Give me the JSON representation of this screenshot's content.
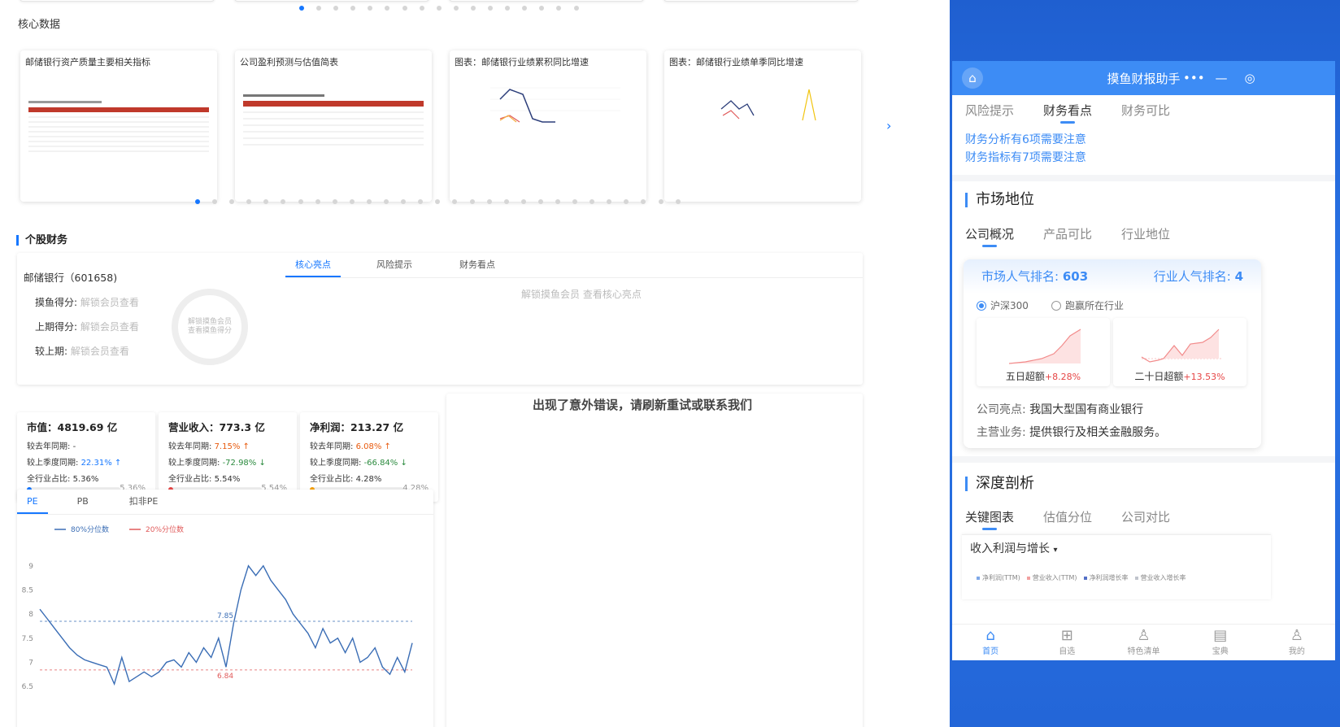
{
  "core_section": {
    "title": "核心数据"
  },
  "cards": [
    {
      "title": "邮储银行资产质量主要相关指标"
    },
    {
      "title": "公司盈利预测与估值简表"
    },
    {
      "title": "图表：邮储银行业绩累积同比增速"
    },
    {
      "title": "图表：邮储银行业绩单季同比增速"
    }
  ],
  "stock_section": {
    "title": "个股财务"
  },
  "stock": {
    "name": "邮储银行（601658)",
    "tabs": [
      "核心亮点",
      "风险提示",
      "财务看点"
    ],
    "active_tab": 0,
    "score_label": "摸鱼得分:",
    "last_score_label": "上期得分:",
    "compare_label": "较上期:",
    "locked_value": "解锁会员查看",
    "ring_text": "解锁摸鱼会员\n查看摸鱼得分",
    "content_placeholder": "解锁摸鱼会员 查看核心亮点"
  },
  "metrics": [
    {
      "title": "市值：4819.69 亿",
      "yoy_label": "较去年同期:",
      "yoy_value": "-",
      "qoq_label": "较上季度同期:",
      "qoq_value": "22.31%",
      "qoq_arrow": "↑",
      "share_label": "全行业占比:",
      "share_value": "5.36%",
      "share_pct": "5.36%",
      "bar_color": "#1677ff",
      "fill": 0.0536
    },
    {
      "title": "营业收入：773.3 亿",
      "yoy_label": "较去年同期:",
      "yoy_value": "7.15%",
      "yoy_arrow": "↑",
      "qoq_label": "较上季度同期:",
      "qoq_value": "-72.98%",
      "qoq_arrow": "↓",
      "share_label": "全行业占比:",
      "share_value": "5.54%",
      "share_pct": "5.54%",
      "bar_color": "#e64545",
      "fill": 0.0554
    },
    {
      "title": "净利润：213.27 亿",
      "yoy_label": "较去年同期:",
      "yoy_value": "6.08%",
      "yoy_arrow": "↑",
      "qoq_label": "较上季度同期:",
      "qoq_value": "-66.84%",
      "qoq_arrow": "↓",
      "share_label": "全行业占比:",
      "share_value": "4.28%",
      "share_pct": "4.28%",
      "bar_color": "#f59f00",
      "fill": 0.0428
    }
  ],
  "error_text": "出现了意外错误，请刷新重试或联系我们",
  "pe_panel": {
    "tabs": [
      "PE",
      "PB",
      "扣非PE"
    ],
    "active_tab": 0
  },
  "chart_data": {
    "type": "line",
    "series": [
      {
        "name": "80%分位数",
        "color": "#3a6db5"
      },
      {
        "name": "20%分位数",
        "color": "#e05a5a"
      }
    ],
    "reference_lines": [
      {
        "label": "7.85",
        "value": 7.85,
        "color": "#3a6db5"
      },
      {
        "name": "6.84",
        "label": "6.84",
        "value": 6.84,
        "color": "#e05a5a"
      }
    ],
    "y_ticks": [
      "9",
      "8.5",
      "8",
      "7.5",
      "7",
      "6.5"
    ],
    "ylim": [
      6.4,
      9.3
    ],
    "values": [
      8.1,
      7.9,
      7.7,
      7.5,
      7.3,
      7.15,
      7.05,
      7.0,
      6.95,
      6.9,
      6.55,
      7.1,
      6.6,
      6.7,
      6.8,
      6.7,
      6.8,
      7.0,
      7.05,
      6.9,
      7.2,
      7.0,
      7.3,
      7.1,
      7.5,
      6.9,
      7.8,
      8.5,
      9.0,
      8.8,
      9.0,
      8.7,
      8.5,
      8.3,
      8.0,
      7.8,
      7.6,
      7.3,
      7.7,
      7.4,
      7.5,
      7.2,
      7.5,
      7.0,
      7.1,
      7.3,
      6.9,
      6.75,
      7.1,
      6.8,
      7.4
    ]
  },
  "phone": {
    "title": "摸鱼财报助手",
    "home_icon": "home-icon",
    "tabs1": [
      "风险提示",
      "财务看点",
      "财务可比"
    ],
    "tabs1_active": 1,
    "link1": "财务分析有6项需要注意",
    "link2": "财务指标有7项需要注意",
    "market_title": "市场地位",
    "tabs2": [
      "公司概况",
      "产品可比",
      "行业地位"
    ],
    "tabs2_active": 0,
    "popularity_label": "市场人气排名:",
    "popularity_value": "603",
    "industry_label": "行业人气排名:",
    "industry_value": "4",
    "radio1": "沪深300",
    "radio2": "跑赢所在行业",
    "mini1_label": "五日超额",
    "mini1_value": "+8.28%",
    "mini2_label": "二十日超额",
    "mini2_value": "+13.53%",
    "highlight_label": "公司亮点:",
    "highlight_value": "我国大型国有商业银行",
    "business_label": "主营业务:",
    "business_value": "提供银行及相关金融服务。",
    "deep_title": "深度剖析",
    "tabs3": [
      "关键图表",
      "估值分位",
      "公司对比"
    ],
    "tabs3_active": 0,
    "chart_select": "收入利润与增长",
    "legend": [
      {
        "name": "净利润(TTM)",
        "color": "#7fa8e8"
      },
      {
        "name": "营业收入(TTM)",
        "color": "#f2a0a0"
      },
      {
        "name": "净利润增长率",
        "color": "#5470c6"
      },
      {
        "name": "营业收入增长率",
        "color": "#c0c4cc"
      }
    ],
    "nav": [
      {
        "label": "首页",
        "icon": "home-icon"
      },
      {
        "label": "自选",
        "icon": "plus-square-icon"
      },
      {
        "label": "特色清单",
        "icon": "user-icon"
      },
      {
        "label": "宝典",
        "icon": "book-icon"
      },
      {
        "label": "我的",
        "icon": "profile-icon"
      }
    ]
  }
}
